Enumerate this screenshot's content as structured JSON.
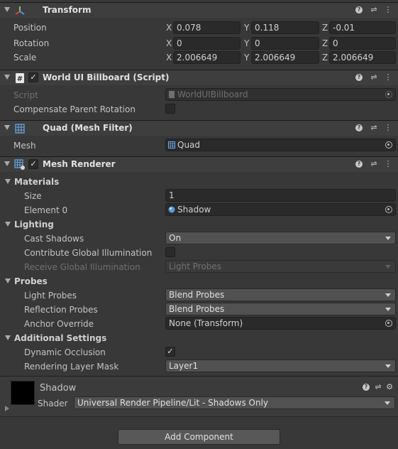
{
  "transform": {
    "title": "Transform",
    "rows": [
      {
        "label": "Position",
        "x": "0.078",
        "y": "0.118",
        "z": "-0.01"
      },
      {
        "label": "Rotation",
        "x": "0",
        "y": "0",
        "z": "0"
      },
      {
        "label": "Scale",
        "x": "2.006649",
        "y": "2.006649",
        "z": "2.006649"
      }
    ],
    "axis": {
      "x": "X",
      "y": "Y",
      "z": "Z"
    }
  },
  "billboard": {
    "title": "World UI Billboard (Script)",
    "script_label": "Script",
    "script_value": "WorldUIBillboard",
    "compensate_label": "Compensate Parent Rotation"
  },
  "mesh_filter": {
    "title": "Quad (Mesh Filter)",
    "mesh_label": "Mesh",
    "mesh_value": "Quad"
  },
  "mesh_renderer": {
    "title": "Mesh Renderer",
    "materials": {
      "header": "Materials",
      "size_label": "Size",
      "size_value": "1",
      "element_label": "Element 0",
      "element_value": "Shadow"
    },
    "lighting": {
      "header": "Lighting",
      "cast_label": "Cast Shadows",
      "cast_value": "On",
      "contrib_label": "Contribute Global Illumination",
      "receive_label": "Receive Global Illumination",
      "receive_value": "Light Probes"
    },
    "probes": {
      "header": "Probes",
      "light_label": "Light Probes",
      "light_value": "Blend Probes",
      "reflection_label": "Reflection Probes",
      "reflection_value": "Blend Probes",
      "anchor_label": "Anchor Override",
      "anchor_value": "None (Transform)"
    },
    "additional": {
      "header": "Additional Settings",
      "occlusion_label": "Dynamic Occlusion",
      "layer_label": "Rendering Layer Mask",
      "layer_value": "Layer1"
    }
  },
  "material": {
    "name": "Shadow",
    "shader_label": "Shader",
    "shader_value": "Universal Render Pipeline/Lit - Shadows Only"
  },
  "add_component": "Add Component"
}
